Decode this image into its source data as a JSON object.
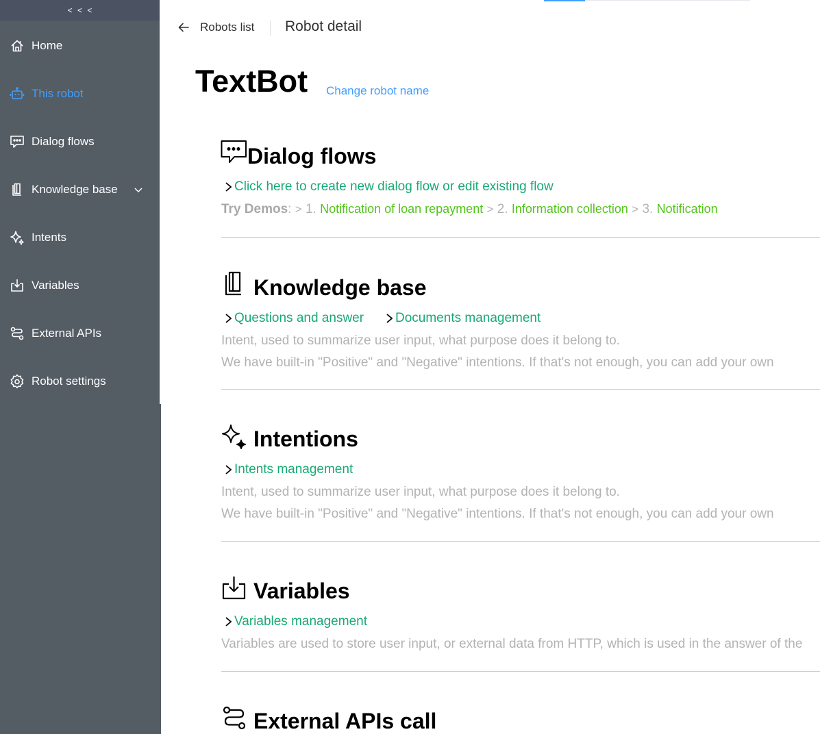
{
  "sidebar": {
    "collapse_label": "< < <",
    "items": [
      {
        "label": "Home",
        "icon": "home-icon"
      },
      {
        "label": "This robot",
        "icon": "robot-icon",
        "active": true
      },
      {
        "label": "Dialog flows",
        "icon": "chat-icon"
      },
      {
        "label": "Knowledge base",
        "icon": "book-icon",
        "has_submenu": true
      },
      {
        "label": "Intents",
        "icon": "sparkle-icon"
      },
      {
        "label": "Variables",
        "icon": "download-icon"
      },
      {
        "label": "External APIs",
        "icon": "route-icon"
      },
      {
        "label": "Robot settings",
        "icon": "gear-icon"
      }
    ]
  },
  "header": {
    "back_label": "Robots list",
    "title": "Robot detail"
  },
  "robot": {
    "name": "TextBot",
    "rename_label": "Change robot name"
  },
  "sections": {
    "dialog": {
      "title": "Dialog flows",
      "link": "Click here to create new dialog flow or edit existing flow",
      "demos_label": "Try Demos",
      "demos": [
        {
          "num": "1.",
          "label": "Notification of loan repayment"
        },
        {
          "num": "2.",
          "label": "Information collection"
        },
        {
          "num": "3.",
          "label": "Notification"
        }
      ]
    },
    "knowledge": {
      "title": "Knowledge base",
      "links": [
        "Questions and answer",
        "Documents management"
      ],
      "desc1": "Intent, used to summarize user input, what purpose does it belong to.",
      "desc2": "We have built-in \"Positive\" and \"Negative\" intentions. If that's not enough, you can add your own"
    },
    "intentions": {
      "title": "Intentions",
      "link": "Intents management",
      "desc1": "Intent, used to summarize user input, what purpose does it belong to.",
      "desc2": "We have built-in \"Positive\" and \"Negative\" intentions. If that's not enough, you can add your own"
    },
    "variables": {
      "title": "Variables",
      "link": "Variables management",
      "desc1": "Variables are used to store user input, or external data from HTTP, which is used in the answer of the"
    },
    "external": {
      "title": "External APIs call"
    }
  },
  "colors": {
    "sidebar_bg": "#545c64",
    "active": "#409eff",
    "link_green": "#19a974",
    "demo_green": "#52c41a"
  }
}
